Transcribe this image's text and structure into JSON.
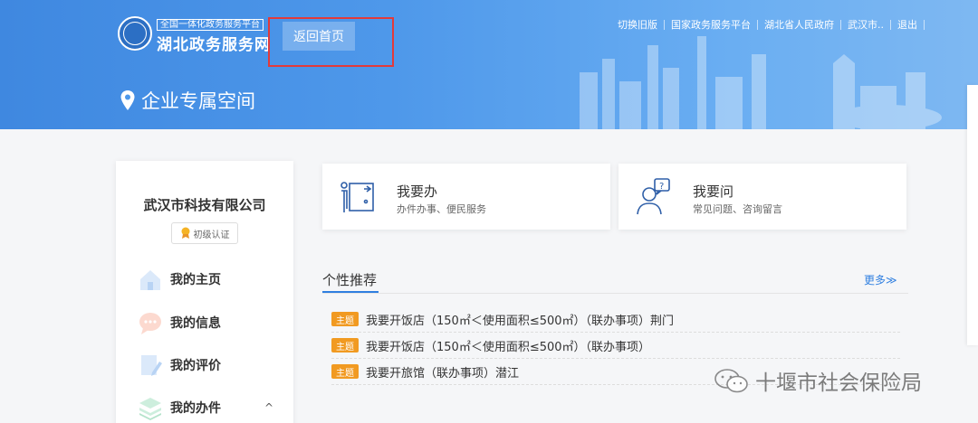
{
  "header": {
    "logo_small": "全国一体化政务服务平台",
    "logo_big": "湖北政务服务网",
    "home_button": "返回首页",
    "nav": [
      "切换旧版",
      "国家政务服务平台",
      "湖北省人民政府",
      "武汉市..",
      "退出"
    ],
    "space_title": "企业专属空间"
  },
  "sidebar": {
    "company": "武汉市科技有限公司",
    "cert": "初级认证",
    "items": [
      {
        "label": "我的主页",
        "icon": "home-icon"
      },
      {
        "label": "我的信息",
        "icon": "chat-icon"
      },
      {
        "label": "我的评价",
        "icon": "edit-icon"
      },
      {
        "label": "我的办件",
        "icon": "layers-icon"
      }
    ],
    "expand_glyph": "^"
  },
  "cards": [
    {
      "title": "我要办",
      "sub": "办件办事、便民服务",
      "icon": "service-desk-icon"
    },
    {
      "title": "我要问",
      "sub": "常见问题、咨询留言",
      "icon": "question-person-icon"
    }
  ],
  "recommend": {
    "title": "个性推荐",
    "more": "更多≫",
    "tag": "主题",
    "items": [
      "我要开饭店（150㎡＜使用面积≤500㎡）（联办事项）荆门",
      "我要开饭店（150㎡＜使用面积≤500㎡）（联办事项）",
      "我要开旅馆（联办事项）潜江"
    ]
  },
  "watermark": "十堰市社会保险局",
  "colors": {
    "accent": "#2f7fe0",
    "tag": "#f19a21",
    "banner": "#4e98ea",
    "annotation": "#e23a3a"
  }
}
